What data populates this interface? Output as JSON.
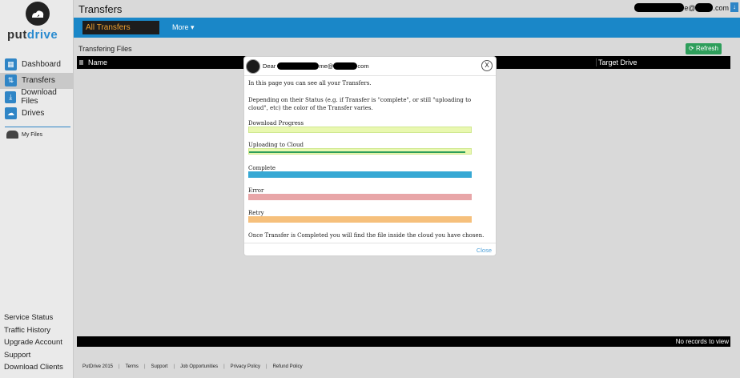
{
  "brand": {
    "logo_prefix": "put",
    "logo_suffix": "drive"
  },
  "sidebar": {
    "items": [
      {
        "label": "Dashboard",
        "icon": "dashboard-icon"
      },
      {
        "label": "Transfers",
        "icon": "transfers-icon"
      },
      {
        "label": "Download Files",
        "icon": "download-icon"
      },
      {
        "label": "Drives",
        "icon": "cloud-icon"
      }
    ],
    "my_files": "My Files",
    "bottom_links": [
      "Service Status",
      "Traffic History",
      "Upgrade Account",
      "Support",
      "Download Clients"
    ]
  },
  "header": {
    "title": "Transfers",
    "email_suffix": "e@",
    "email_domain_suffix": ".com"
  },
  "tabs": {
    "active": "All Transfers",
    "more": "More"
  },
  "main": {
    "section_title": "Transfering Files",
    "refresh_label": "Refresh",
    "columns": [
      "Name",
      "Target Drive"
    ],
    "empty_text": "No records to view"
  },
  "footer": [
    "PutDrive 2015",
    "Terms",
    "Support",
    "Job Opportunities",
    "Privacy Policy",
    "Refund Policy"
  ],
  "modal": {
    "greeting": "Dear",
    "email_mid": "me@",
    "email_end": "com",
    "close_x": "X",
    "intro": "In this page you can see all your Transfers.",
    "description": "Depending on their Status (e.g. if Transfer is \"complete\", or still \"uploading to cloud\", etc) the color of the Transfer varies.",
    "statuses": [
      {
        "label": "Download Progress",
        "color": "#e9f8b0"
      },
      {
        "label": "Uploading to Cloud",
        "color": "#e9f8b0",
        "accent": "#2e9e5b"
      },
      {
        "label": "Complete",
        "color": "#36a8d4"
      },
      {
        "label": "Error",
        "color": "#e8a6a8"
      },
      {
        "label": "Retry",
        "color": "#f6c07c"
      }
    ],
    "note": "Once Transfer is Completed you will find the file inside the cloud you have chosen.",
    "close_label": "Close"
  }
}
